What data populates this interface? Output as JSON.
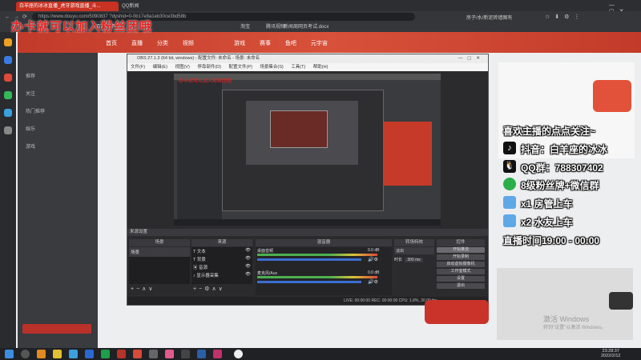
{
  "browser": {
    "tabs": [
      {
        "label": "白羊座的冰冰直播_虎牙游戏直播_斗...",
        "active": true
      },
      {
        "label": "QQ新闻",
        "active": false
      },
      {
        "label": "腾讯视频",
        "active": false
      },
      {
        "label": "腾讯视频",
        "active": false
      },
      {
        "label": "新闻",
        "active": false
      }
    ],
    "url": "https://www.douyu.com/5090837 ?dyshid=0-0b17e8a1eb30ce3bd58b",
    "bookmarks": [
      "百度一下",
      "一个页面",
      "我的空间",
      "问我",
      "淘宝",
      "腾讯视频",
      "新闻周",
      "网页考试.docx"
    ],
    "right_tools": "房子/水/新泥砖墙图有"
  },
  "overlay_banner": "办卡就可以加入粉丝团哦",
  "site": {
    "nav": [
      "首页",
      "直播",
      "分类",
      "视频",
      "游戏",
      "赛事",
      "鱼吧",
      "元宇宙"
    ],
    "left_menu": [
      "推荐",
      "关注",
      "热门推荐",
      "娱乐",
      "游戏",
      "专题",
      "鱼吧"
    ]
  },
  "obs": {
    "title": "OBS 27.1.3 (64 bit, windows) - 配置文件: 未命名 - 场景: 未命名",
    "menu": [
      "文件(F)",
      "编辑(E)",
      "视图(V)",
      "停靠部件(D)",
      "配置文件(P)",
      "场景集合(S)",
      "工具(T)",
      "帮助(H)"
    ],
    "dock_header": "来源设置",
    "panels": {
      "scenes": "场景",
      "sources": "来源",
      "mixer": "混音器",
      "transitions": "转场特效",
      "controls": "控件"
    },
    "scene_item": "场景",
    "source_items": [
      "文本",
      "背景",
      "音源",
      "显示器采集"
    ],
    "mixer_tracks": [
      {
        "name": "桌面音频",
        "level": "0.0 dB"
      },
      {
        "name": "麦克风/Aux",
        "level": "0.0 dB"
      }
    ],
    "transition_value": "淡出",
    "duration_label": "时长",
    "duration_value": "300 ms",
    "controls": [
      "开始推流",
      "开始录制",
      "启动虚拟摄像机",
      "工作室模式",
      "设置",
      "退出"
    ],
    "status": "LIVE: 00:00:00   REC: 00:00:00   CPU: 1.8%, 30.00 fps"
  },
  "right_overlay": {
    "follow": "喜欢主播的点点关注~",
    "lines": [
      {
        "icon": "tiktok-icon",
        "text": "抖音：白羊座的冰冰"
      },
      {
        "icon": "qq-icon",
        "text": "QQ群：788307402"
      },
      {
        "icon": "wechat-icon",
        "text": "8级粉丝牌+微信群"
      },
      {
        "icon": "plane-icon",
        "text": "x1 房管上车"
      },
      {
        "icon": "plane-icon",
        "text": "x2 水友上车"
      }
    ],
    "schedule": "直播时间19:00 - 00:00"
  },
  "activate": {
    "title": "激活 Windows",
    "subtitle": "转到\"设置\"以激活 Windows。"
  },
  "taskbar": {
    "time": "23:28:37",
    "date": "2022/2/12"
  },
  "colors": {
    "accent": "#e8221f",
    "site_header": "#c23b2a",
    "obs_bg": "#2b2b2e",
    "overlay_text": "#ffffff"
  }
}
